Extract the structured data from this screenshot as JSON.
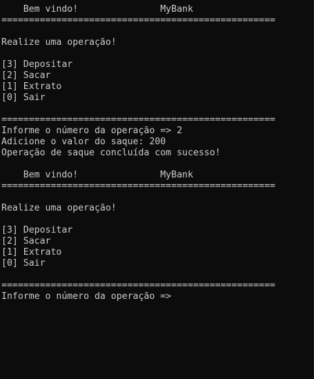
{
  "terminal": {
    "lines": [
      "    Bem vindo!               MyBank",
      "==================================================",
      "",
      "Realize uma operação!",
      "",
      "[3] Depositar",
      "[2] Sacar",
      "[1] Extrato",
      "[0] Sair",
      "",
      "==================================================",
      "Informe o número da operação => 2",
      "Adicione o valor do saque: 200",
      "Operação de saque concluída com sucesso!",
      "",
      "    Bem vindo!               MyBank",
      "==================================================",
      "",
      "Realize uma operação!",
      "",
      "[3] Depositar",
      "[2] Sacar",
      "[1] Extrato",
      "[0] Sair",
      "",
      "==================================================",
      "Informe o número da operação => "
    ]
  },
  "colors": {
    "background": "#0c0c0c",
    "text": "#cccccc"
  }
}
